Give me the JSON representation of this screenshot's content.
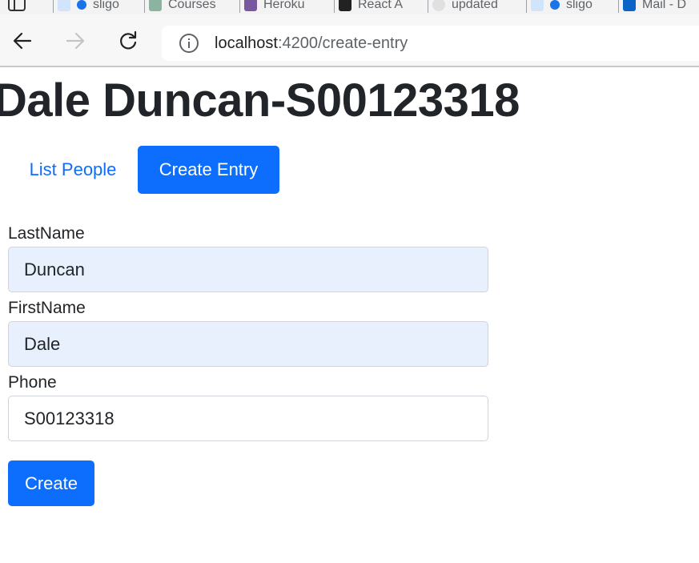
{
  "browser": {
    "tabs": [
      {
        "label": "sligo",
        "icon": "search-icon",
        "color": "#1a73e8"
      },
      {
        "label": "Courses",
        "icon": "courses-icon",
        "color": "#8ab4a0"
      },
      {
        "label": "Heroku",
        "icon": "heroku-icon",
        "color": "#79589f"
      },
      {
        "label": "React A",
        "icon": "react-icon",
        "color": "#222222"
      },
      {
        "label": "updated",
        "icon": "close-circle-icon",
        "color": "#888888"
      },
      {
        "label": "sligo",
        "icon": "search-icon",
        "color": "#1a73e8"
      },
      {
        "label": "Mail - D",
        "icon": "outlook-icon",
        "color": "#0a64c8"
      }
    ],
    "url_host": "localhost",
    "url_path": ":4200/create-entry"
  },
  "page": {
    "title": "Dale Duncan-S00123318",
    "nav": {
      "list_label": "List People",
      "create_label": "Create Entry"
    },
    "form": {
      "lastname_label": "LastName",
      "lastname_value": "Duncan",
      "firstname_label": "FirstName",
      "firstname_value": "Dale",
      "phone_label": "Phone",
      "phone_value": "S00123318",
      "submit_label": "Create"
    }
  },
  "colors": {
    "primary": "#0d6efd",
    "autofill_bg": "#e8f0fe",
    "text": "#212529"
  }
}
